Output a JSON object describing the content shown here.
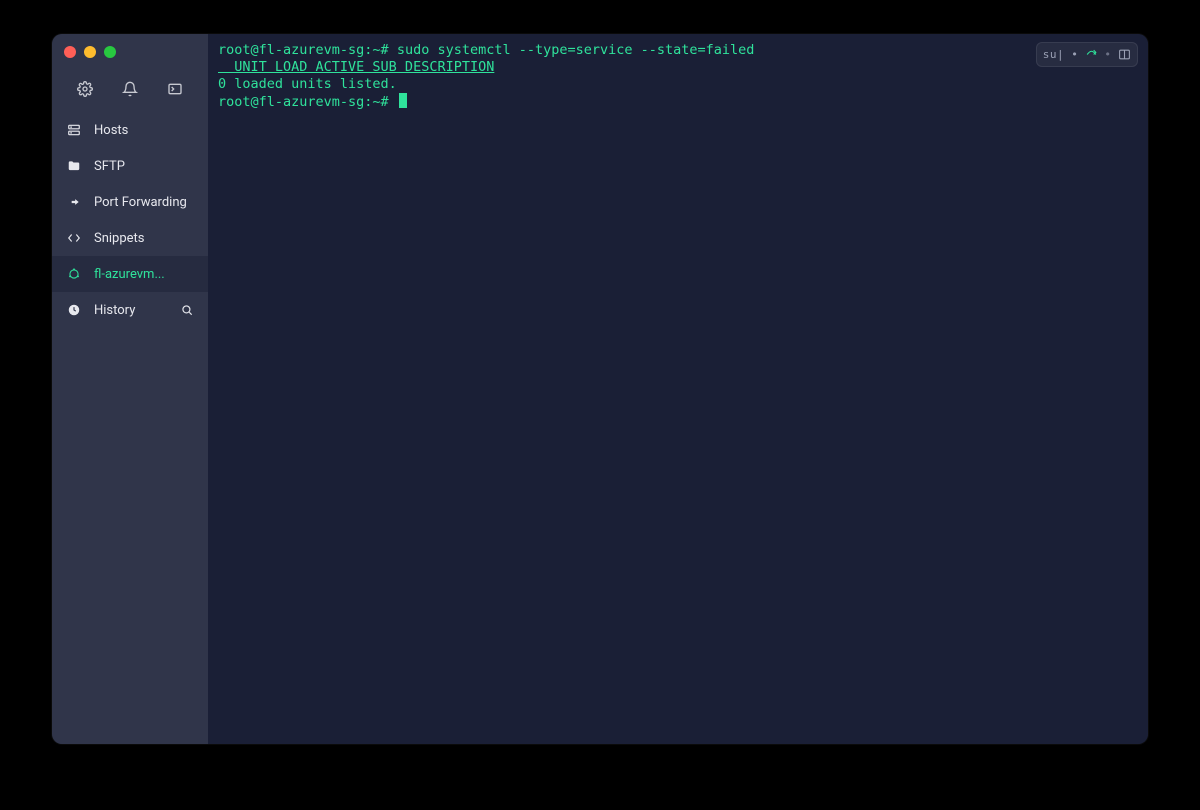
{
  "sidebar": {
    "items": [
      {
        "label": "Hosts"
      },
      {
        "label": "SFTP"
      },
      {
        "label": "Port Forwarding"
      },
      {
        "label": "Snippets"
      },
      {
        "label": "fl-azurevm..."
      },
      {
        "label": "History"
      }
    ]
  },
  "terminal": {
    "line1_prompt": "root@fl-azurevm-sg:~# ",
    "line1_cmd": "sudo systemctl --type=service --state=failed",
    "line2": "  UNIT LOAD ACTIVE SUB DESCRIPTION",
    "line3": "0 loaded units listed.",
    "line4_prompt": "root@fl-azurevm-sg:~# "
  },
  "topright": {
    "badge": "su| •"
  }
}
